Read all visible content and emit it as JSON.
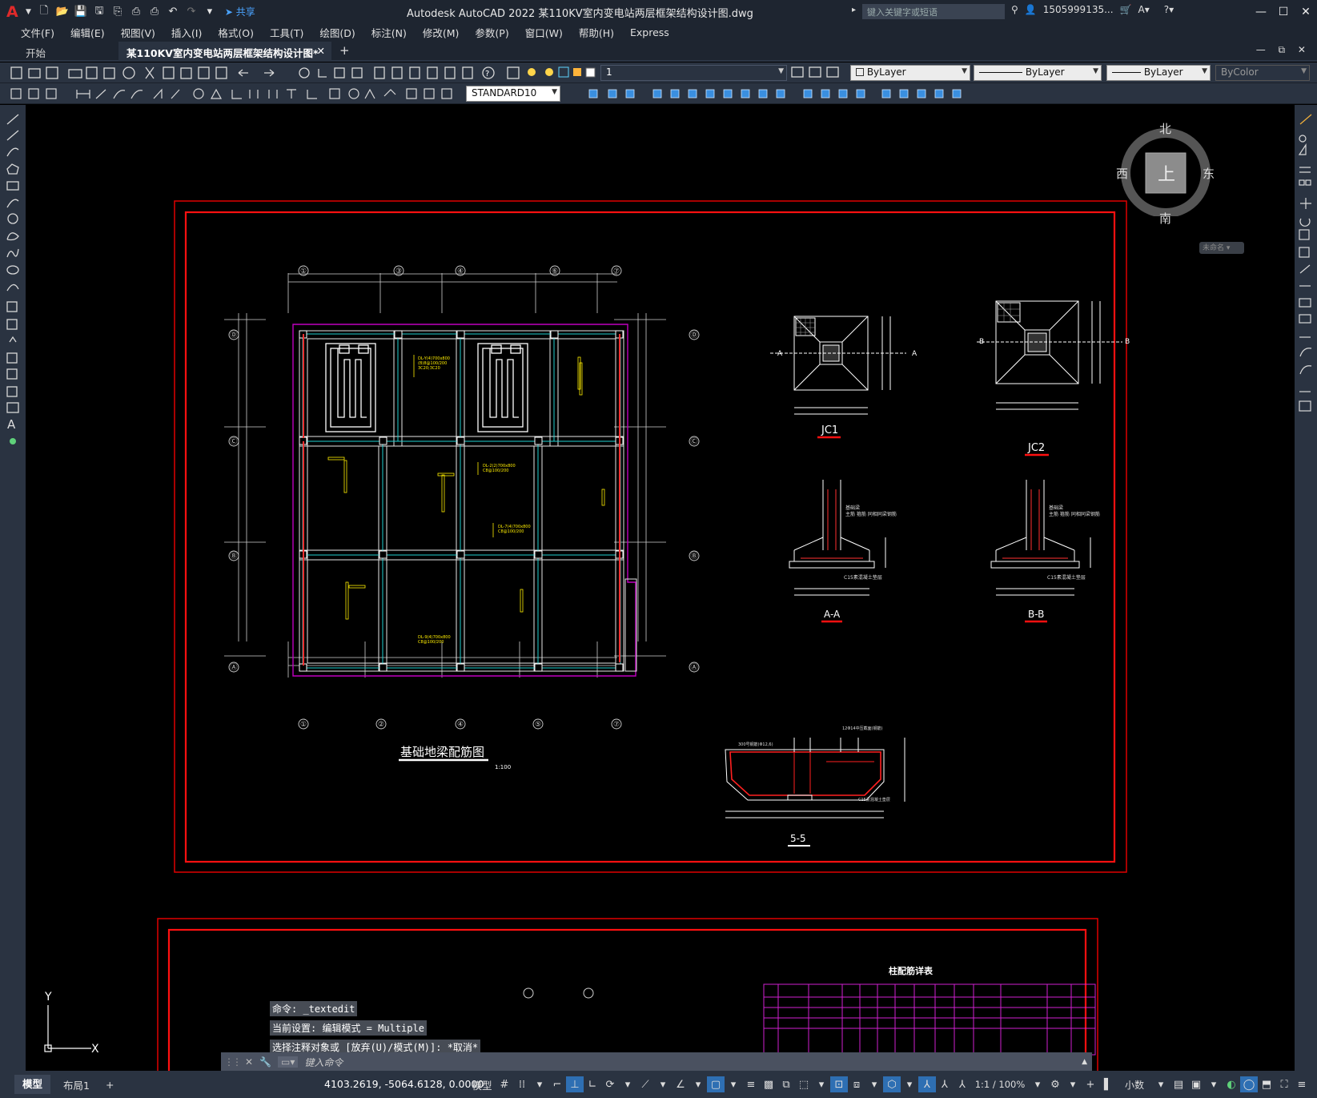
{
  "title_bar": {
    "logo": "A",
    "share_label": "共享",
    "app_title": "Autodesk AutoCAD 2022    某110KV室内变电站两层框架结构设计图.dwg",
    "search_placeholder": "键入关键字或短语",
    "user_name": "1505999135...",
    "window_buttons": [
      "minimize-icon",
      "maximize-icon",
      "close-icon"
    ]
  },
  "menu": [
    "文件(F)",
    "编辑(E)",
    "视图(V)",
    "插入(I)",
    "格式(O)",
    "工具(T)",
    "绘图(D)",
    "标注(N)",
    "修改(M)",
    "参数(P)",
    "窗口(W)",
    "帮助(H)",
    "Express"
  ],
  "tabs": {
    "start": "开始",
    "active": "某110KV室内变电站两层框架结构设计图*",
    "close": "✕",
    "add": "+"
  },
  "toolbar": {
    "layer_value": "1",
    "color_value": "ByLayer",
    "linetype_value": "ByLayer",
    "lineweight_value": "ByLayer",
    "plotstyle_value": "ByColor",
    "dimstyle_value": "STANDARD10"
  },
  "viewcube": {
    "north": "北",
    "south": "南",
    "east": "东",
    "west": "西",
    "top": "上",
    "ucs": "未命名"
  },
  "drawing": {
    "plan_title": "基础地梁配筋图",
    "plan_scale": "1:100",
    "jc1": "JC1",
    "jc2": "JC2",
    "section_aa": "A-A",
    "section_bb": "B-B",
    "section_55": "5-5",
    "table_title": "柱配筋详表",
    "axis_top": [
      "①",
      "③",
      "④",
      "⑥",
      "⑦"
    ],
    "axis_bottom": [
      "①",
      "②",
      "④",
      "⑤",
      "⑦"
    ],
    "axis_side": [
      "Ⓓ",
      "Ⓒ",
      "Ⓑ",
      "Ⓐ"
    ],
    "ucs_x": "X",
    "ucs_y": "Y"
  },
  "command_history": [
    "命令: _textedit",
    "当前设置: 编辑模式 = Multiple",
    "选择注释对象或 [放弃(U)/模式(M)]: *取消*"
  ],
  "command_placeholder": "键入命令",
  "status": {
    "model_tab": "模型",
    "layout_tab": "布局1",
    "add": "+",
    "coords": "4103.2619, -5064.6128, 0.0000",
    "model_label": "模型",
    "scale": "1:1 / 100%",
    "units": "小数"
  }
}
